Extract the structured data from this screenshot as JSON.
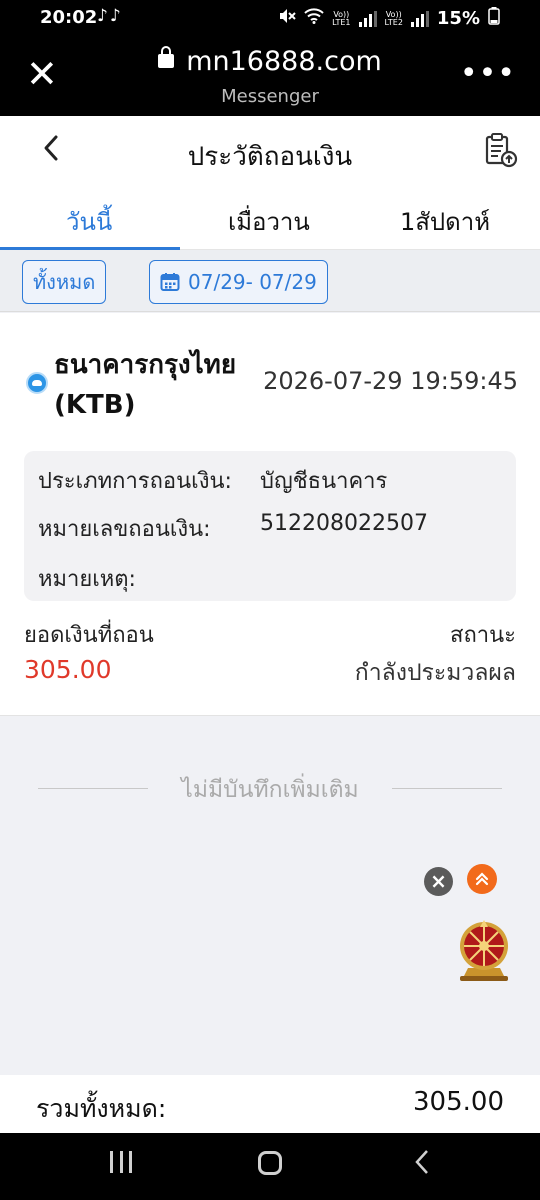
{
  "status_bar": {
    "time": "20:02",
    "app_icons": "♪♪",
    "volte1": "Vo))\nLTE1",
    "volte2": "Vo))\nLTE2",
    "battery": "15%"
  },
  "browser": {
    "url": "mn16888.com",
    "app": "Messenger"
  },
  "header": {
    "title": "ประวัติถอนเงิน"
  },
  "tabs": [
    {
      "label": "วันนี้",
      "active": true
    },
    {
      "label": "เมื่อวาน",
      "active": false
    },
    {
      "label": "1สัปดาห์",
      "active": false
    }
  ],
  "filters": {
    "all_label": "ทั้งหมด",
    "date_range": "07/29- 07/29"
  },
  "record": {
    "bank_name": "ธนาคารกรุงไทย (KTB)",
    "datetime": "2026-07-29 19:59:45",
    "withdraw_type_label": "ประเภทการถอนเงิน:",
    "withdraw_type_value": "บัญชีธนาคาร",
    "withdraw_number_label": "หมายเลขถอนเงิน:",
    "withdraw_number_value": "512208022507",
    "note_label": "หมายเหตุ:",
    "amount_label": "ยอดเงินที่ถอน",
    "amount_value": "305.00",
    "status_label": "สถานะ",
    "status_value": "กำลังประมวลผล"
  },
  "no_more_text": "ไม่มีบันทึกเพิ่มเติม",
  "footer": {
    "total_label": "รวมทั้งหมด:",
    "total_value": "305.00"
  },
  "colors": {
    "accent": "#2d7ad8",
    "amount": "#e0392a",
    "float_top": "#f26a1b"
  },
  "icons": [
    "close-icon",
    "lock-icon",
    "more-icon",
    "back-arrow-icon",
    "history-clipboard-icon",
    "calendar-icon",
    "bank-icon",
    "close-float-icon",
    "scroll-top-icon",
    "prize-wheel-icon"
  ]
}
